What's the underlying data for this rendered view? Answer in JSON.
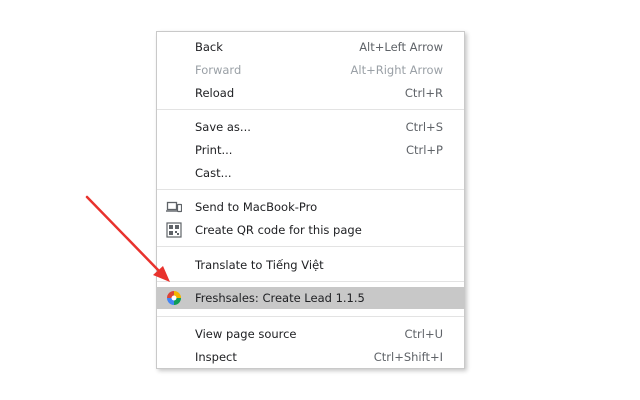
{
  "menu": {
    "items": [
      {
        "label": "Back",
        "shortcut": "Alt+Left Arrow"
      },
      {
        "label": "Forward",
        "shortcut": "Alt+Right Arrow"
      },
      {
        "label": "Reload",
        "shortcut": "Ctrl+R"
      },
      {
        "label": "Save as...",
        "shortcut": "Ctrl+S"
      },
      {
        "label": "Print...",
        "shortcut": "Ctrl+P"
      },
      {
        "label": "Cast...",
        "shortcut": ""
      },
      {
        "label": "Send to MacBook-Pro",
        "shortcut": "",
        "icon": "laptop-phone-icon"
      },
      {
        "label": "Create QR code for this page",
        "shortcut": "",
        "icon": "qr-code-icon"
      },
      {
        "label": "Translate to Tiếng Việt",
        "shortcut": ""
      },
      {
        "label": "Freshsales: Create Lead 1.1.5",
        "shortcut": "",
        "icon": "freshsales-icon",
        "highlighted": true
      },
      {
        "label": "View page source",
        "shortcut": "Ctrl+U"
      },
      {
        "label": "Inspect",
        "shortcut": "Ctrl+Shift+I"
      }
    ]
  },
  "annotation": {
    "arrow_color": "#e8322d"
  },
  "colors": {
    "highlight": "#c8c8c8",
    "disabled_text": "#9aa0a6"
  }
}
